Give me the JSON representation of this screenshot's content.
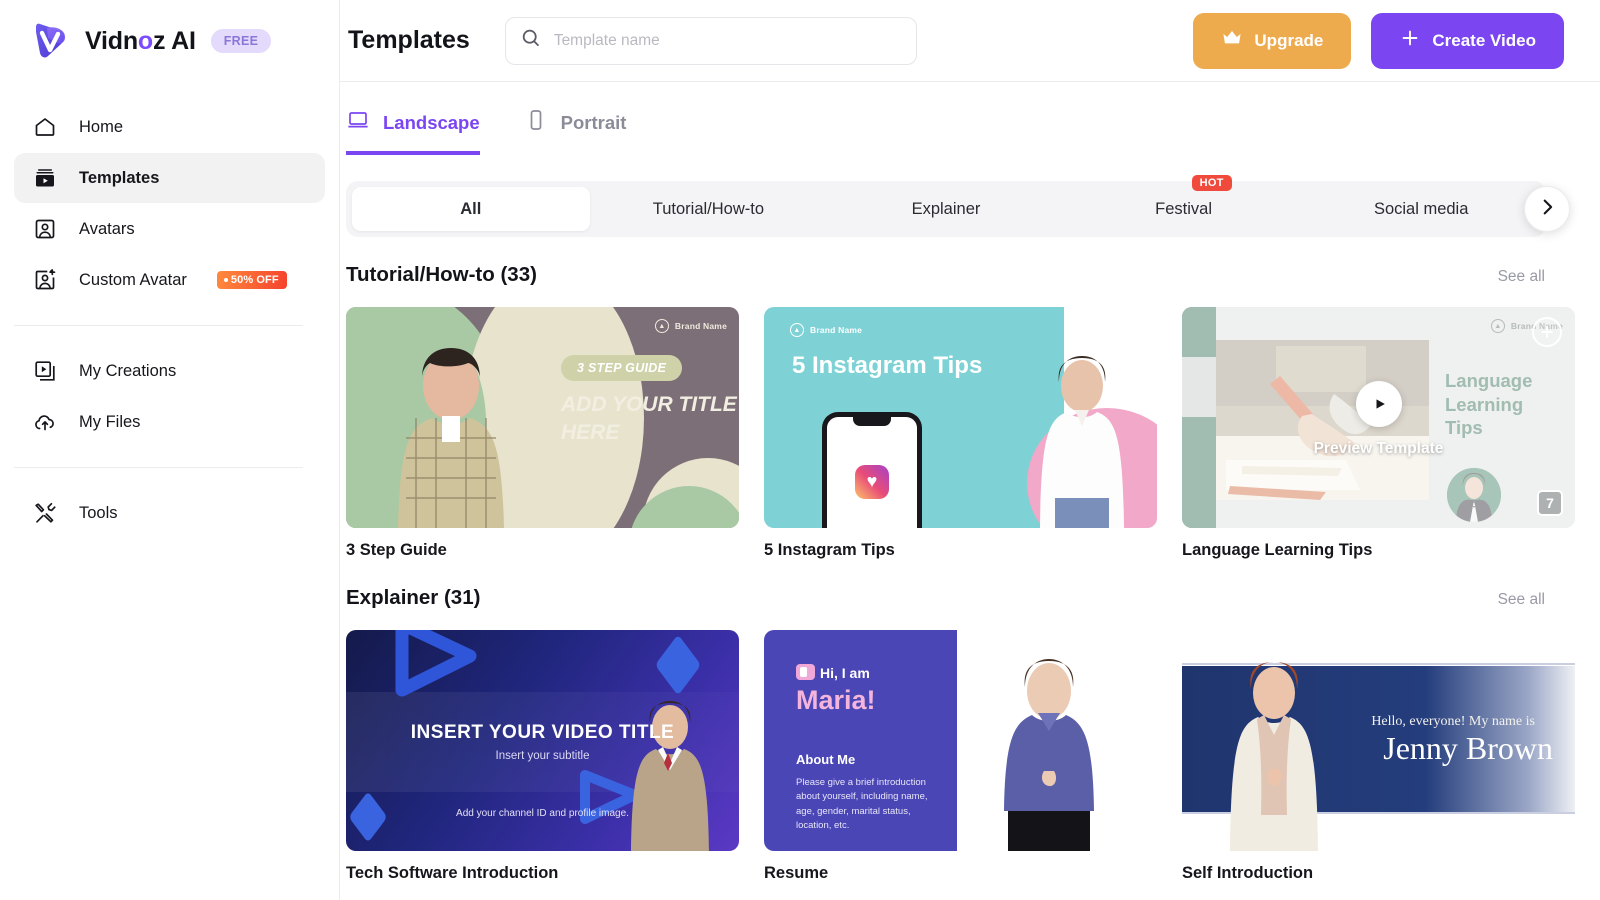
{
  "brand": {
    "name_part1": "Vidn",
    "name_o": "o",
    "name_part2": "z AI",
    "plan_badge": "FREE",
    "logo_icon": "vidnoz-play-logo"
  },
  "sidebar": {
    "items_primary": [
      {
        "label": "Home",
        "icon": "home-icon",
        "active": false
      },
      {
        "label": "Templates",
        "icon": "templates-icon",
        "active": true
      },
      {
        "label": "Avatars",
        "icon": "avatar-icon",
        "active": false
      },
      {
        "label": "Custom Avatar",
        "icon": "custom-avatar-icon",
        "active": false,
        "badge": "50% OFF"
      }
    ],
    "items_secondary": [
      {
        "label": "My Creations",
        "icon": "my-creations-icon"
      },
      {
        "label": "My Files",
        "icon": "cloud-upload-icon"
      }
    ],
    "items_tertiary": [
      {
        "label": "Tools",
        "icon": "tools-icon"
      }
    ]
  },
  "header": {
    "title": "Templates",
    "search_placeholder": "Template name",
    "search_value": "",
    "search_icon": "search-icon",
    "upgrade_label": "Upgrade",
    "upgrade_icon": "crown-icon",
    "upgrade_color": "#eeab4e",
    "create_label": "Create Video",
    "create_icon": "plus-icon",
    "create_color": "#7b46f2"
  },
  "orientation_tabs": [
    {
      "label": "Landscape",
      "icon": "laptop-icon",
      "active": true
    },
    {
      "label": "Portrait",
      "icon": "phone-icon",
      "active": false
    }
  ],
  "categories": [
    {
      "label": "All",
      "active": true
    },
    {
      "label": "Tutorial/How-to",
      "active": false
    },
    {
      "label": "Explainer",
      "active": false
    },
    {
      "label": "Festival",
      "active": false,
      "badge": "HOT"
    },
    {
      "label": "Social media",
      "active": false
    }
  ],
  "carousel_arrow_icon": "chevron-right-icon",
  "sections": [
    {
      "title": "Tutorial/How-to (33)",
      "see_all": "See all",
      "cards": [
        {
          "title": "3 Step Guide",
          "art": "c1",
          "art_text": {
            "brand": "Brand Name",
            "pill": "3 STEP GUIDE",
            "headline": "ADD YOUR TITLE HERE"
          }
        },
        {
          "title": "5 Instagram Tips",
          "art": "c2",
          "art_text": {
            "brand": "Brand Name",
            "headline": "5 Instagram Tips"
          }
        },
        {
          "title": "Language Learning Tips",
          "art": "c3",
          "hovered": true,
          "art_text": {
            "brand": "Brand Name",
            "headline": "Language Learning Tips"
          },
          "overlay": {
            "preview_label": "Preview Template",
            "scene_count": "7",
            "play_icon": "play-icon",
            "add_icon": "plus-circle-icon"
          }
        }
      ]
    },
    {
      "title": "Explainer (31)",
      "see_all": "See all",
      "cards": [
        {
          "title": "Tech Software Introduction",
          "art": "c4",
          "art_text": {
            "headline": "INSERT YOUR VIDEO TITLE",
            "subtitle": "Insert your subtitle",
            "footer": "Add your channel ID and profile image."
          }
        },
        {
          "title": "Resume",
          "art": "c5",
          "art_text": {
            "greeting": "Hi, I am",
            "name": "Maria!",
            "about_title": "About Me",
            "about_body": "Please give a brief introduction about yourself, including name, age, gender, marital status, location, etc."
          }
        },
        {
          "title": "Self Introduction",
          "art": "c6",
          "art_text": {
            "greeting": "Hello, everyone! My name is",
            "name": "Jenny Brown"
          }
        }
      ]
    }
  ]
}
